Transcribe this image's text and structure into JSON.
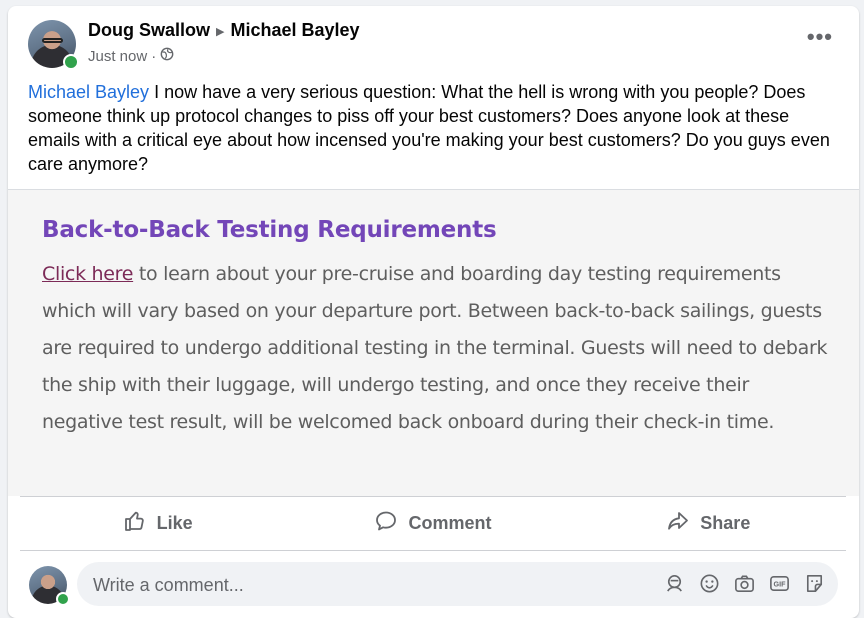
{
  "post": {
    "author": "Doug Swallow",
    "recipient": "Michael Bayley",
    "timestamp": "Just now",
    "separator": "·",
    "mention": "Michael Bayley",
    "text": " I now have a very serious question: What the hell is wrong with you people? Does someone think up protocol changes to piss off your best customers? Does anyone look at these emails with a critical eye about how incensed you're making your best customers? Do you guys even care anymore?"
  },
  "attachment": {
    "title": "Back-to-Back Testing Requirements",
    "link_text": "Click here",
    "body": " to learn about your pre-cruise and boarding day testing requirements which will vary based on your departure port. Between back-to-back sailings, guests are required to undergo additional testing in the terminal. Guests will need to debark the ship with their luggage, will undergo testing, and once they receive their negative test result, will be welcomed back onboard during their check-in time."
  },
  "actions": {
    "like": "Like",
    "comment": "Comment",
    "share": "Share"
  },
  "comment_box": {
    "placeholder": "Write a comment...",
    "icons": [
      "avatar-sticker-icon",
      "emoji-icon",
      "camera-icon",
      "gif-icon",
      "sticker-icon"
    ]
  },
  "colors": {
    "mention": "#216fdb",
    "attachment_title": "#7346b8",
    "attachment_link": "#7c2a57",
    "online": "#31a24c"
  }
}
